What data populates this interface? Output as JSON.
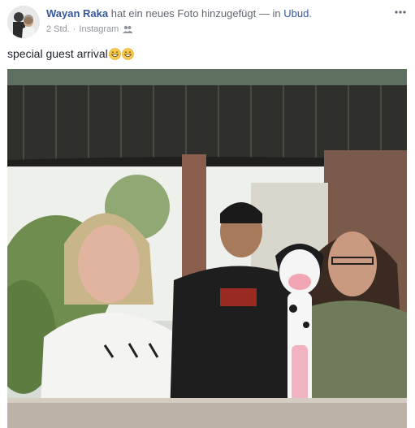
{
  "post": {
    "author": "Wayan Raka",
    "action": "hat ein neues Foto hinzugefügt — in",
    "location": "Ubud",
    "location_suffix": ".",
    "time": "2 Std.",
    "source": "Instagram",
    "audience_icon": "friends-icon",
    "more_icon": "more-options-icon",
    "caption": "special guest arrival",
    "caption_emojis": [
      "grinning-face-emoji",
      "grinning-face-emoji"
    ]
  },
  "colors": {
    "link": "#365899",
    "meta": "#90949c",
    "text": "#1d2129"
  }
}
